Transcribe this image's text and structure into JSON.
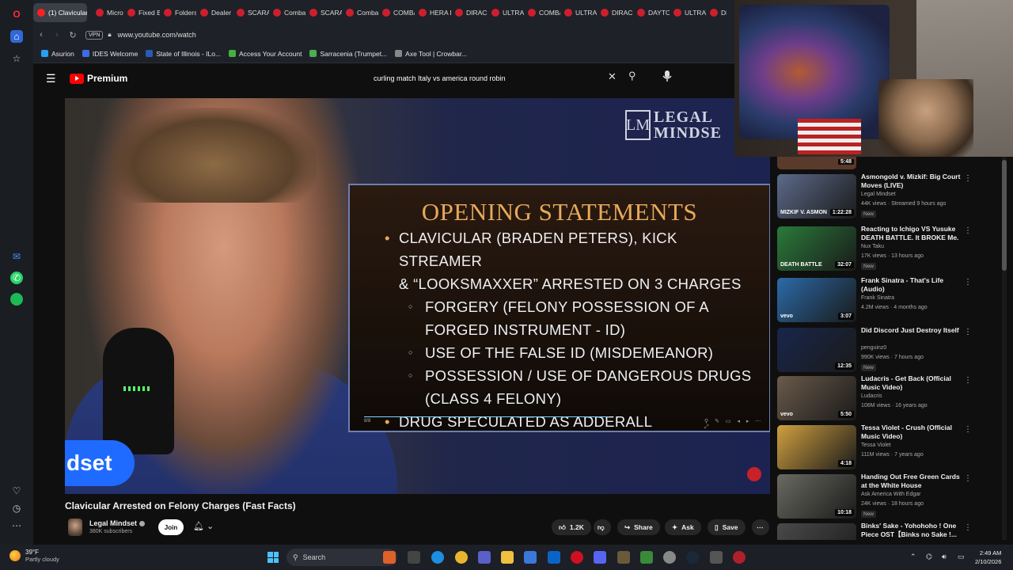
{
  "browser": {
    "tabs": [
      {
        "label": "(1) Clavicular",
        "active": true
      },
      {
        "label": "Microt"
      },
      {
        "label": "Fixed B"
      },
      {
        "label": "Folders"
      },
      {
        "label": "Dealer"
      },
      {
        "label": "SCARA"
      },
      {
        "label": "Comba"
      },
      {
        "label": "SCARA"
      },
      {
        "label": "Comba"
      },
      {
        "label": "COMBA"
      },
      {
        "label": "HERA D"
      },
      {
        "label": "DIRAC"
      },
      {
        "label": "ULTRA"
      },
      {
        "label": "COMBA"
      },
      {
        "label": "ULTRA"
      },
      {
        "label": "DIRAC"
      },
      {
        "label": "DAYTO"
      },
      {
        "label": "ULTRA"
      },
      {
        "label": "Di"
      }
    ],
    "vpn_label": "VPN",
    "url": "www.youtube.com/watch",
    "bookmarks": [
      "Asurion",
      "IDES Welcome",
      "State of Illinois - ILo...",
      "Access Your Account",
      "Sarracenia (Trumpet...",
      "Axe Tool | Crowbar..."
    ]
  },
  "youtube": {
    "logo_text": "Premium",
    "search_query": "curling match Italy vs america round robin",
    "video_title": "Clavicular Arrested on Felony Charges (Fast Facts)",
    "channel": {
      "name": "Legal Mindset",
      "subscribers": "380K subscribers",
      "join_label": "Join"
    },
    "actions": {
      "likes": "1.2K",
      "share": "Share",
      "ask": "Ask",
      "save": "Save"
    },
    "video_overlay": {
      "brand_line1": "LEGAL",
      "brand_line2": "MINDSE",
      "badge_text": "dset",
      "slide": {
        "title": "OPENING STATEMENTS",
        "bullet1_line1": "CLAVICULAR (BRADEN PETERS), KICK STREAMER",
        "bullet1_line2": "& “LOOKSMAXXER” ARRESTED ON 3 CHARGES",
        "sub1_line1": "FORGERY (FELONY POSSESSION OF A",
        "sub1_line2": "FORGED INSTRUMENT - ID)",
        "sub2": "USE OF THE FALSE ID (MISDEMEANOR)",
        "sub3_line1": "POSSESSION / USE OF DANGEROUS DRUGS",
        "sub3_line2": "(CLASS 4 FELONY)",
        "bullet2": "DRUG SPECULATED AS ADDERALL",
        "controls_text": "8/8"
      }
    },
    "top_partial_duration": "5:48",
    "recommendations": [
      {
        "title": "Asmongold v. Mizkif: Big Court Moves (LIVE)",
        "channel": "Legal Mindset",
        "meta": "44K views · Streamed 9 hours ago",
        "badge": "New",
        "duration": "1:22:28",
        "thumb_text": "MIZKIF V. ASMON",
        "thumb_color": "#5c6a8a"
      },
      {
        "title": "Reacting to Ichigo VS Yusuke DEATH BATTLE. It BROKE Me.",
        "channel": "Nux Taku",
        "meta": "17K views · 13 hours ago",
        "badge": "New",
        "duration": "32:07",
        "thumb_text": "DEATH BATTLE",
        "thumb_color": "#2a7a3a"
      },
      {
        "title": "Frank Sinatra - That's Life (Audio)",
        "channel": "Frank Sinatra",
        "meta": "4.2M views · 4 months ago",
        "badge": "",
        "duration": "3:07",
        "thumb_text": "vevo",
        "thumb_color": "#2b6aa8"
      },
      {
        "title": "Did Discord Just Destroy Itself",
        "channel": "penguinz0",
        "meta": "990K views · 7 hours ago",
        "badge": "New",
        "duration": "12:35",
        "thumb_text": "",
        "thumb_color": "#18264a"
      },
      {
        "title": "Ludacris - Get Back (Official Music Video)",
        "channel": "Ludacris",
        "meta": "106M views · 16 years ago",
        "badge": "",
        "duration": "5:50",
        "thumb_text": "vevo",
        "thumb_color": "#6a5a4a"
      },
      {
        "title": "Tessa Violet - Crush (Official Music Video)",
        "channel": "Tessa Violet",
        "meta": "111M views · 7 years ago",
        "badge": "",
        "duration": "4:18",
        "thumb_text": "",
        "thumb_color": "#d0a040"
      },
      {
        "title": "Handing Out Free Green Cards at the White House",
        "channel": "Ask America With Edgar",
        "meta": "24K views · 18 hours ago",
        "badge": "New",
        "duration": "10:18",
        "thumb_text": "",
        "thumb_color": "#6a6a62"
      },
      {
        "title": "Binks' Sake - Yohohoho ! One Piece OST【Binks no Sake !...",
        "channel": "",
        "meta": "",
        "badge": "",
        "duration": "",
        "thumb_text": "",
        "thumb_color": "#4a4a4a"
      }
    ]
  },
  "taskbar": {
    "weather_temp": "39°F",
    "weather_desc": "Partly cloudy",
    "search_label": "Search",
    "time": "2:49 AM",
    "date": "2/10/2026"
  },
  "colors": {
    "yt_red": "#ff0000",
    "slide_gold": "#e7a95a",
    "brand_blue": "#1f6bff"
  }
}
